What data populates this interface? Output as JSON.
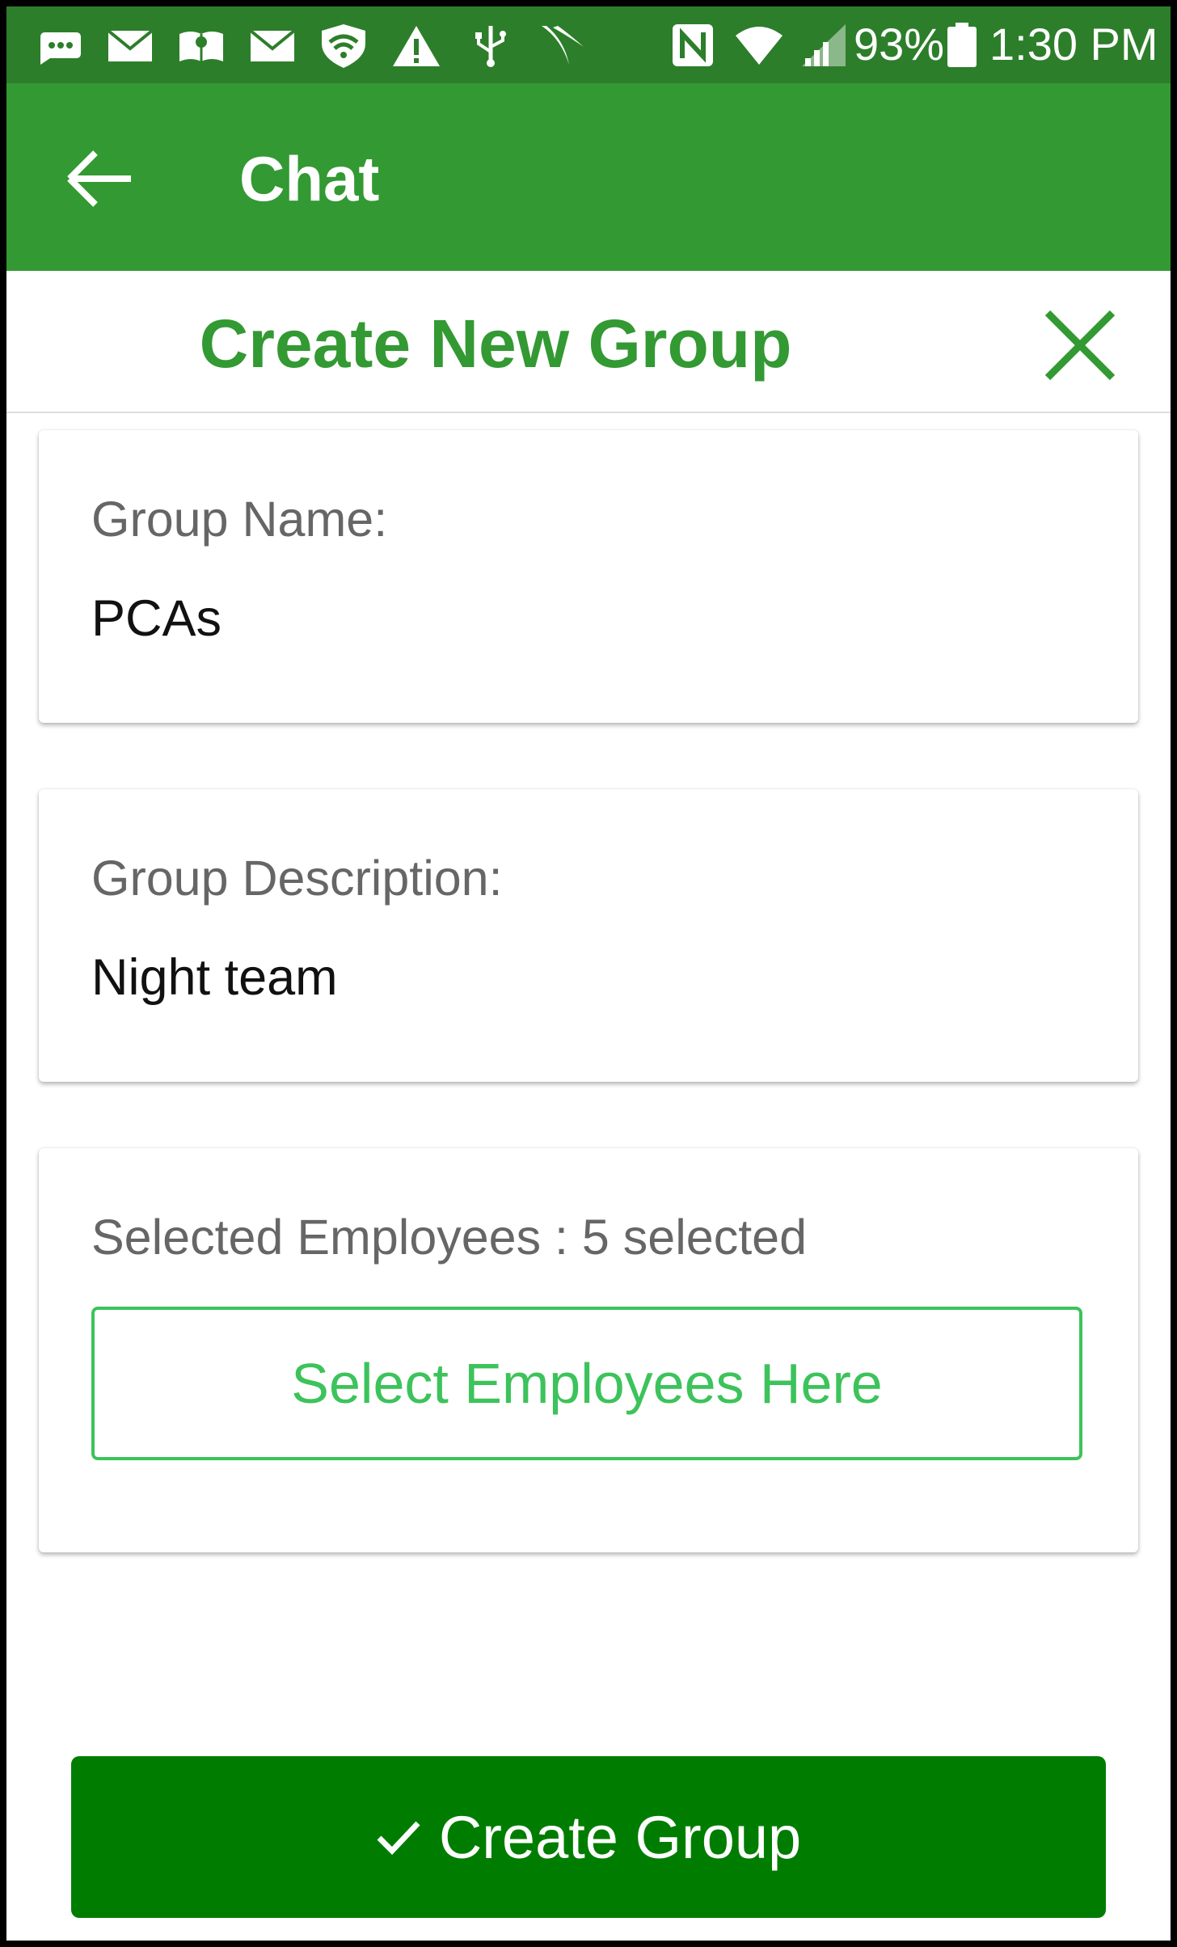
{
  "colors": {
    "status_bar": "#2d7e2a",
    "app_bar": "#339933",
    "accent": "#339933",
    "select_outline": "#3cc35b",
    "primary_button": "#007d00"
  },
  "status_bar": {
    "icons": [
      "message-icon",
      "mail-icon",
      "amazon-kindle-icon",
      "mail-icon",
      "wifi-shield-icon",
      "warning-icon",
      "usb-icon",
      "sprint-icon",
      "nfc-icon",
      "wifi-icon",
      "cell-signal-icon",
      "battery-icon"
    ],
    "battery_text": "93%",
    "time": "1:30 PM"
  },
  "app_bar": {
    "back_icon": "arrow-back-icon",
    "title": "Chat"
  },
  "dialog": {
    "title": "Create New Group",
    "close_icon": "close-icon",
    "group_name_label": "Group Name:",
    "group_name_value": "PCAs",
    "group_description_label": "Group Description:",
    "group_description_value": "Night team",
    "selected_employees_label": "Selected Employees : 5 selected",
    "select_employees_button": "Select Employees Here",
    "create_button_icon": "checkmark-icon",
    "create_button": "Create Group"
  }
}
